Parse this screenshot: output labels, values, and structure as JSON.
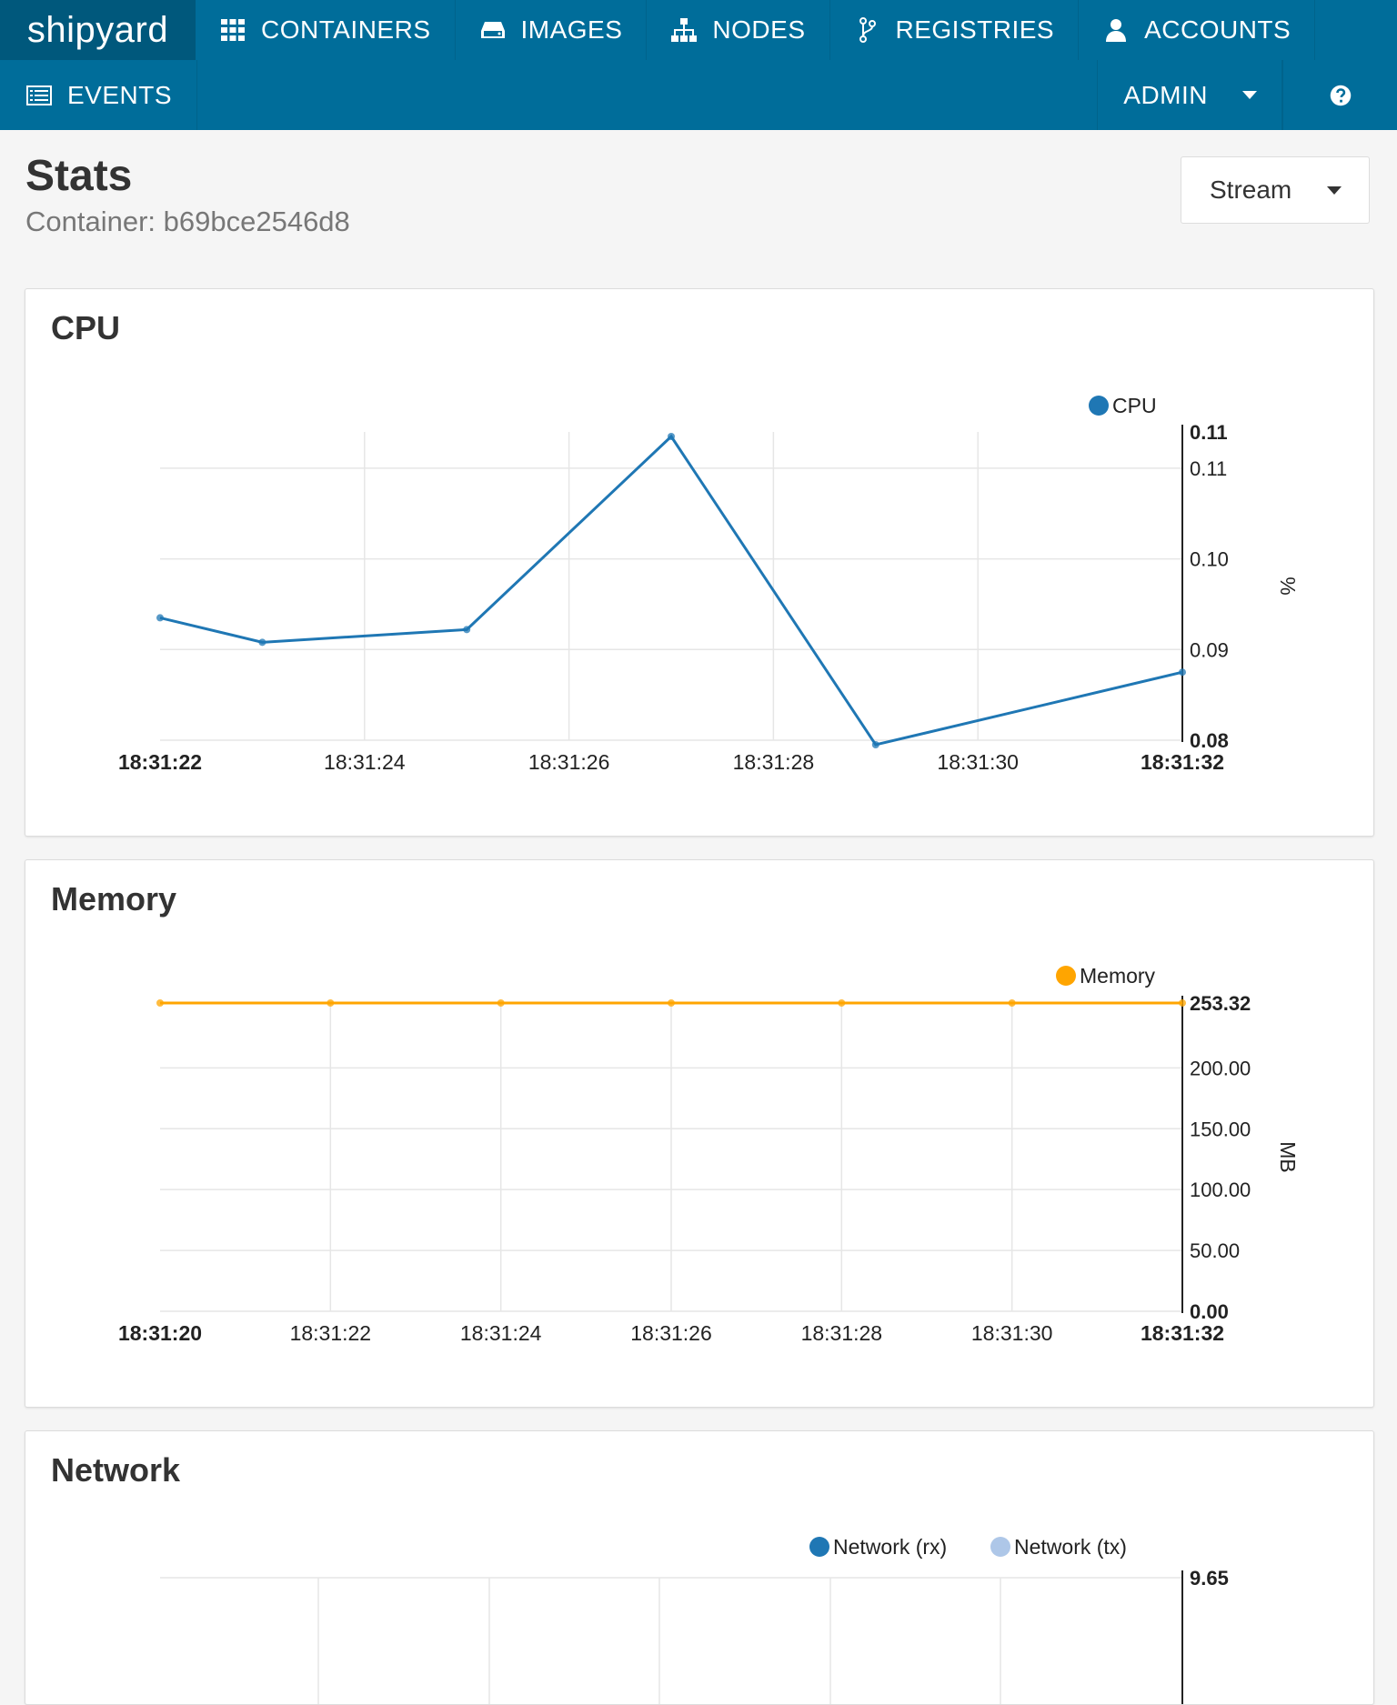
{
  "nav": {
    "brand": "shipyard",
    "items": [
      {
        "label": "CONTAINERS",
        "icon": "grid-icon"
      },
      {
        "label": "IMAGES",
        "icon": "drive-icon"
      },
      {
        "label": "NODES",
        "icon": "sitemap-icon"
      },
      {
        "label": "REGISTRIES",
        "icon": "fork-icon"
      },
      {
        "label": "ACCOUNTS",
        "icon": "user-icon"
      }
    ],
    "events": {
      "label": "EVENTS",
      "icon": "list-icon"
    },
    "admin": "ADMIN",
    "help_icon": "help-icon",
    "color": "#006d9a",
    "brand_bg": "#00587c"
  },
  "page": {
    "title": "Stats",
    "subtitle": "Container: b69bce2546d8",
    "stream_select": "Stream"
  },
  "chart_data": [
    {
      "type": "line",
      "title": "CPU",
      "x": [
        "18:31:22",
        "18:31:23",
        "18:31:25",
        "18:31:27",
        "18:31:29",
        "18:31:32"
      ],
      "xticks": [
        "18:31:22",
        "18:31:24",
        "18:31:26",
        "18:31:28",
        "18:31:30",
        "18:31:32"
      ],
      "series": [
        {
          "name": "CPU",
          "color": "#1f77b4",
          "values": [
            0.0935,
            0.0908,
            0.0922,
            0.1135,
            0.0795,
            0.0875
          ]
        }
      ],
      "yticks": [
        "0.08",
        "0.09",
        "0.10",
        "0.11",
        "0.11"
      ],
      "ylim_labels": [
        "0.08",
        "0.11"
      ],
      "ylabel": "%",
      "grid": true,
      "legend": "top-right"
    },
    {
      "type": "line",
      "title": "Memory",
      "x": [
        "18:31:20",
        "18:31:22",
        "18:31:24",
        "18:31:26",
        "18:31:28",
        "18:31:30",
        "18:31:32"
      ],
      "xticks": [
        "18:31:20",
        "18:31:22",
        "18:31:24",
        "18:31:26",
        "18:31:28",
        "18:31:30",
        "18:31:32"
      ],
      "series": [
        {
          "name": "Memory",
          "color": "#ffa500",
          "values": [
            253.32,
            253.32,
            253.32,
            253.32,
            253.32,
            253.32,
            253.32
          ]
        }
      ],
      "yticks": [
        "0.00",
        "50.00",
        "100.00",
        "150.00",
        "200.00",
        "253.32"
      ],
      "ylabel": "MB",
      "grid": true,
      "legend": "top-right"
    },
    {
      "type": "line",
      "title": "Network",
      "series": [
        {
          "name": "Network (rx)",
          "color": "#1f77b4",
          "values": []
        },
        {
          "name": "Network (tx)",
          "color": "#aec7e8",
          "values": []
        }
      ],
      "yticks": [
        "9.65"
      ],
      "grid": true,
      "legend": "top-right"
    }
  ]
}
